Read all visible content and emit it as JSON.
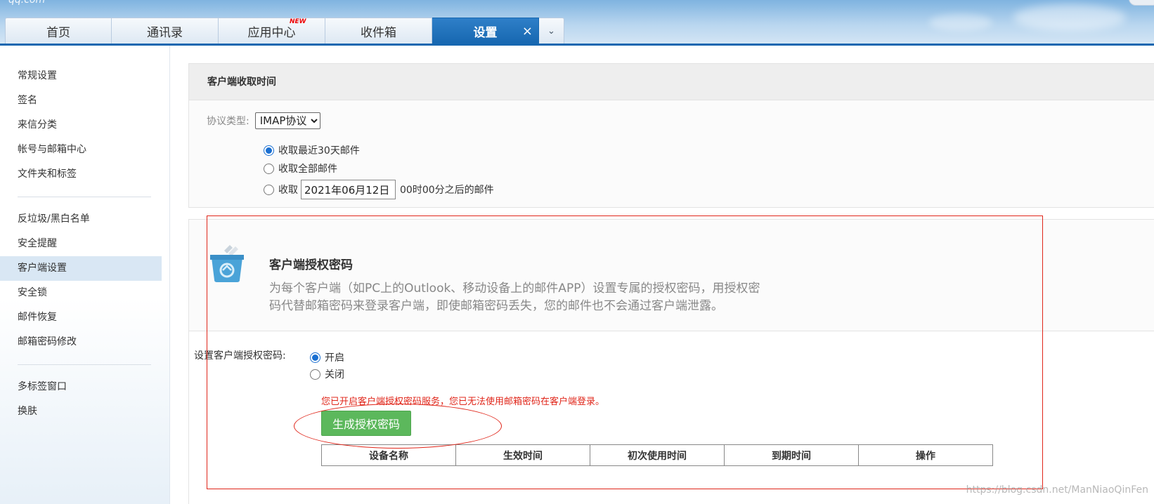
{
  "header": {
    "logo_fragment": "qq.com",
    "tabs": [
      {
        "label": "首页"
      },
      {
        "label": "通讯录"
      },
      {
        "label": "应用中心",
        "badge": "NEW"
      },
      {
        "label": "收件箱"
      },
      {
        "label": "设置",
        "active": true
      }
    ],
    "close_glyph": "×",
    "more_glyph": "⌄"
  },
  "sidebar": {
    "group1": [
      "常规设置",
      "签名",
      "来信分类",
      "帐号与邮箱中心",
      "文件夹和标签"
    ],
    "group2": [
      "反垃圾/黑白名单",
      "安全提醒",
      "客户端设置",
      "安全锁",
      "邮件恢复",
      "邮箱密码修改"
    ],
    "group3": [
      "多标签窗口",
      "换肤"
    ],
    "active": "客户端设置"
  },
  "fetch": {
    "title": "客户端收取时间",
    "protocol_label": "协议类型:",
    "protocol_value": "IMAP协议",
    "opt_recent": "收取最近30天邮件",
    "opt_all": "收取全部邮件",
    "opt_after_prefix": "收取",
    "date_value": "2021年06月12日",
    "opt_after_suffix": "00时00分之后的邮件"
  },
  "auth": {
    "icon": "client-auth-icon",
    "title": "客户端授权密码",
    "desc": "为每个客户端（如PC上的Outlook、移动设备上的邮件APP）设置专属的授权密码，用授权密码代替邮箱密码来登录客户端，即使邮箱密码丢失，您的邮件也不会通过客户端泄露。",
    "setting_label": "设置客户端授权密码:",
    "opt_on": "开启",
    "opt_off": "关闭",
    "warning": "您已开启客户端授权密码服务，您已无法使用邮箱密码在客户端登录。",
    "generate_button": "生成授权密码",
    "table_headers": [
      "设备名称",
      "生效时间",
      "初次使用时间",
      "到期时间",
      "操作"
    ]
  },
  "watermark": "https://blog.csdn.net/ManNiaoQinFen",
  "colors": {
    "accent": "#1667b0",
    "annotation": "#e0261a",
    "button_green": "#5cb85c"
  }
}
